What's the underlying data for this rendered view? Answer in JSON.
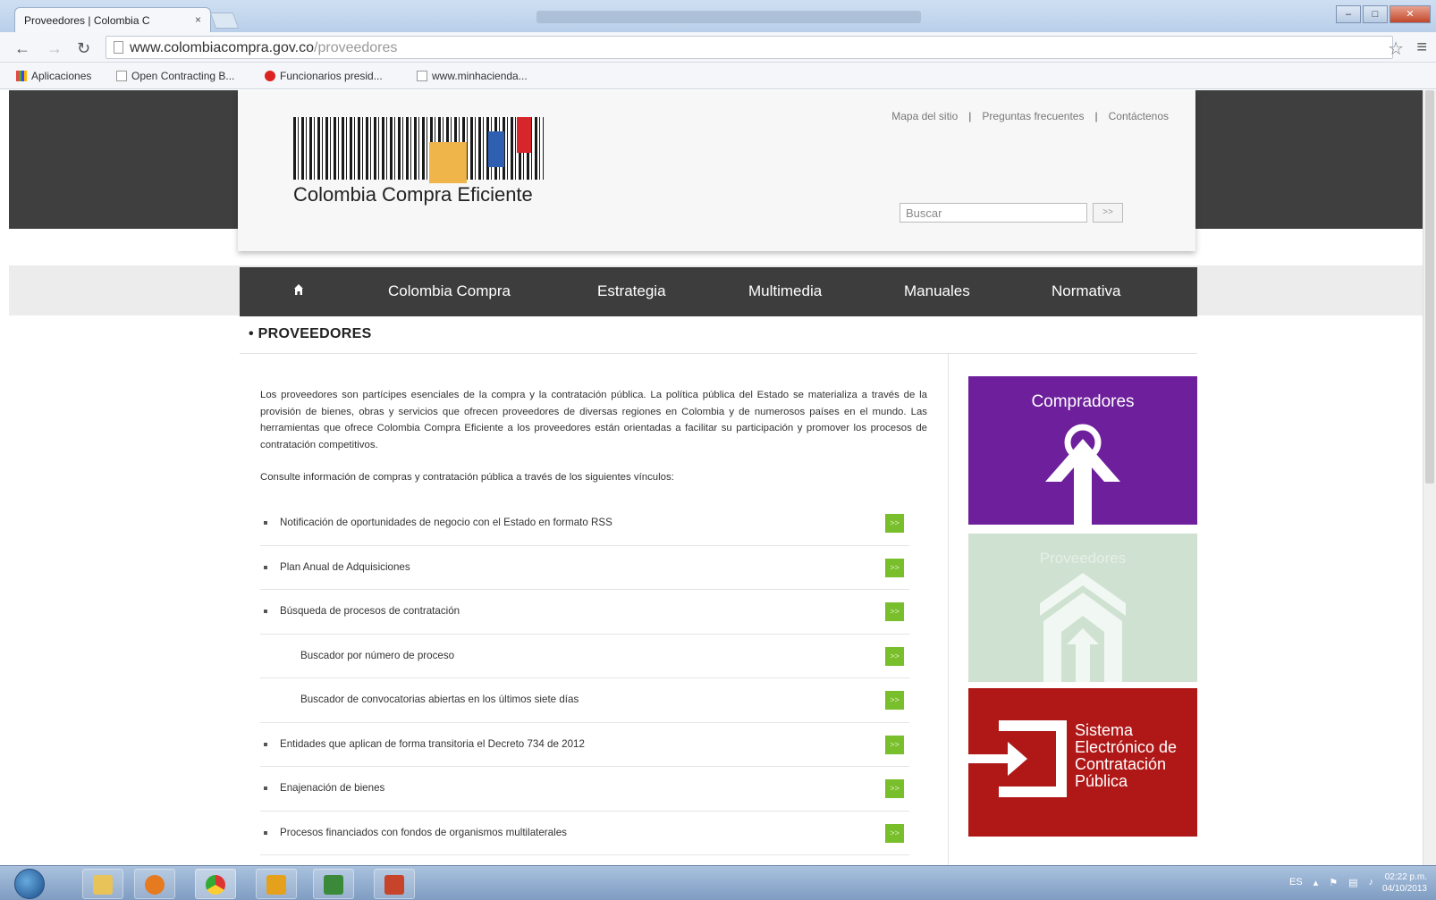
{
  "browser": {
    "tab_title": "Proveedores | Colombia C",
    "tab_close": "×",
    "url_host": "www.colombiacompra.gov.co",
    "url_path": "/proveedores",
    "bookmarks": [
      {
        "label": "Aplicaciones",
        "icon": "apps-grid-icon"
      },
      {
        "label": "Open Contracting B...",
        "icon": "page-icon"
      },
      {
        "label": "Funcionarios presid...",
        "icon": "circle-icon"
      },
      {
        "label": "www.minhacienda...",
        "icon": "page-icon"
      }
    ]
  },
  "header": {
    "logo_text": "Colombia Compra Eficiente",
    "top_links": [
      "Mapa del sitio",
      "Preguntas frecuentes",
      "Contáctenos"
    ],
    "search_placeholder": "Buscar",
    "search_button": ">>"
  },
  "nav": {
    "items": [
      "Colombia Compra",
      "Estrategia",
      "Multimedia",
      "Manuales",
      "Normativa"
    ]
  },
  "main": {
    "section_title": "PROVEEDORES",
    "intro": "Los proveedores son partícipes esenciales de la compra y la contratación pública. La política pública del Estado se materializa a través de la provisión de bienes, obras y servicios que ofrecen proveedores de diversas regiones en Colombia y de numerosos países en el mundo. Las herramientas que ofrece Colombia Compra Eficiente a los proveedores están orientadas a facilitar su participación y promover los procesos de contratación competitivos.",
    "consult": "Consulte información de compras y contratación pública a través de los siguientes vínculos:",
    "links": [
      {
        "label": "Notificación de oportunidades de negocio con el Estado en formato RSS",
        "sub": false
      },
      {
        "label": "Plan Anual de Adquisiciones",
        "sub": false
      },
      {
        "label": "Búsqueda de procesos de contratación",
        "sub": false
      },
      {
        "label": "Buscador por número de proceso",
        "sub": true
      },
      {
        "label": "Buscador de convocatorias abiertas en los últimos siete días",
        "sub": true
      },
      {
        "label": "Entidades que aplican de forma transitoria el Decreto 734 de 2012",
        "sub": false
      },
      {
        "label": "Enajenación de bienes",
        "sub": false
      },
      {
        "label": "Procesos financiados con fondos de organismos multilaterales",
        "sub": false
      }
    ],
    "go_label": ">>"
  },
  "sidebar": {
    "tiles": [
      {
        "title": "Compradores",
        "color": "#6d1f9c"
      },
      {
        "title": "Proveedores",
        "color": "#cfe1d1"
      },
      {
        "title": "Sistema Electrónico de Contratación Pública",
        "color": "#b01818"
      }
    ],
    "sece_lines": [
      "Sistema",
      "Electrónico de",
      "Contratación",
      "Pública"
    ]
  },
  "taskbar": {
    "lang": "ES",
    "time": "02:22 p.m.",
    "date": "04/10/2013"
  }
}
